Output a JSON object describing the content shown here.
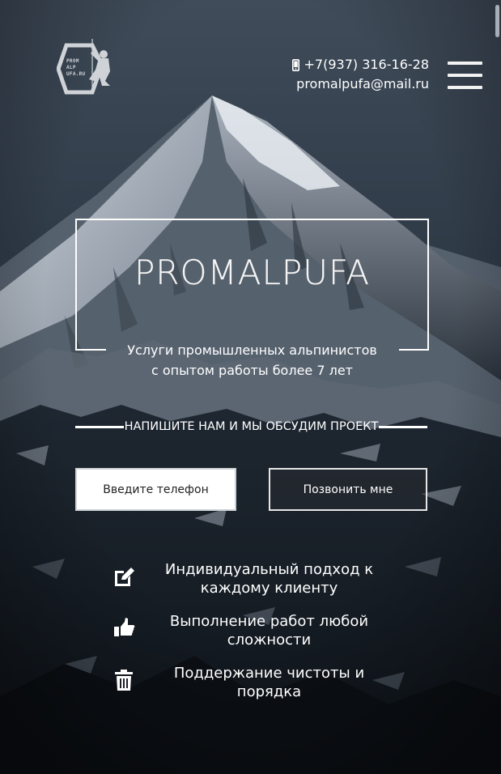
{
  "header": {
    "logo_text": [
      "PROM",
      "ALP",
      "UFA.RU"
    ],
    "phone": "+7(937) 316-16-28",
    "email": "promalpufa@mail.ru",
    "icons": {
      "phone": "mobile-phone-icon",
      "menu": "hamburger-menu-icon"
    }
  },
  "hero": {
    "title": "PROMALPUFA",
    "subtitle_line1": "Услуги промышленных альпинистов",
    "subtitle_line2": "с опытом работы более 7 лет"
  },
  "cta": {
    "text": "НАПИШИТЕ НАМ И МЫ ОБСУДИМ ПРОЕКТ",
    "phone_placeholder": "Введите телефон",
    "call_button_label": "Позвонить мне"
  },
  "features": [
    {
      "icon": "edit-icon",
      "line1": "Индивидуальный подход к",
      "line2": "каждому клиенту"
    },
    {
      "icon": "thumbs-up-icon",
      "line1": "Выполнение работ любой",
      "line2": "сложности"
    },
    {
      "icon": "trash-icon",
      "line1": "Поддержание чистоты и",
      "line2": "порядка"
    }
  ],
  "colors": {
    "sky_top": "#3a4654",
    "sky_bottom": "#1c2530",
    "text": "#ffffff",
    "input_bg": "#ffffff"
  }
}
